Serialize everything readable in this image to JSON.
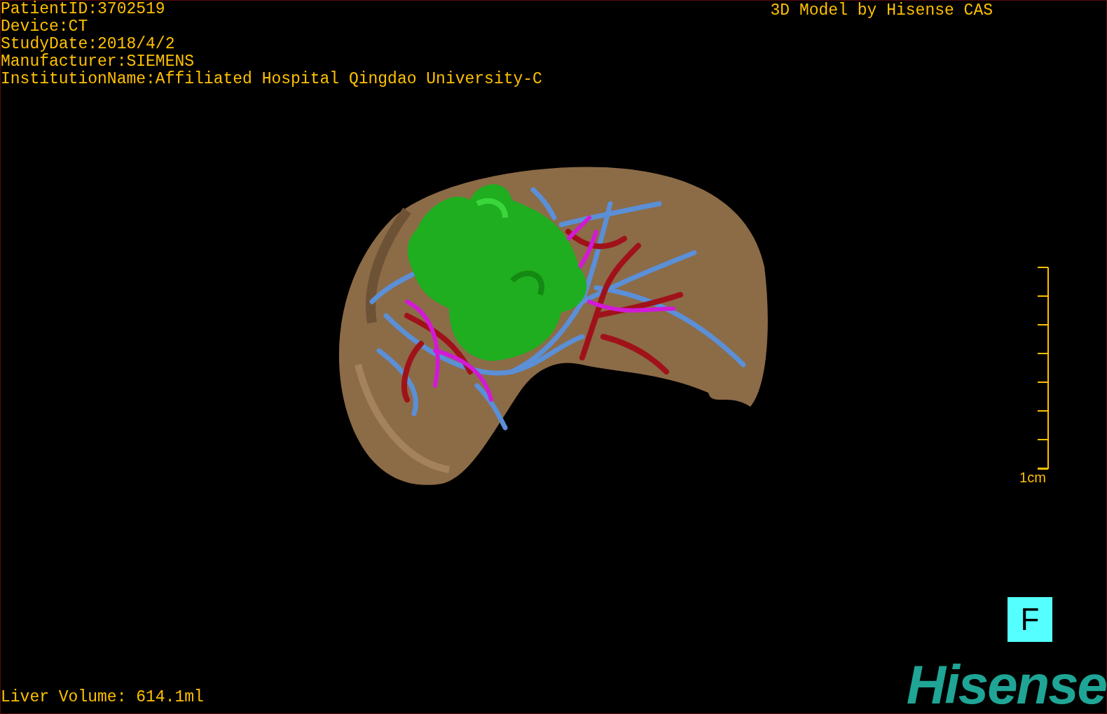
{
  "study_info": [
    "PatientID:3702519",
    "Device:CT",
    "StudyDate:2018/4/2",
    "Manufacturer:SIEMENS",
    "InstitutionName:Affiliated Hospital Qingdao University-C"
  ],
  "credit": "3D Model by Hisense CAS",
  "scale_bar": {
    "label": "1cm"
  },
  "orientation_marker": "F",
  "liver_volume": "Liver Volume: 614.1ml",
  "logo": "Hisense"
}
